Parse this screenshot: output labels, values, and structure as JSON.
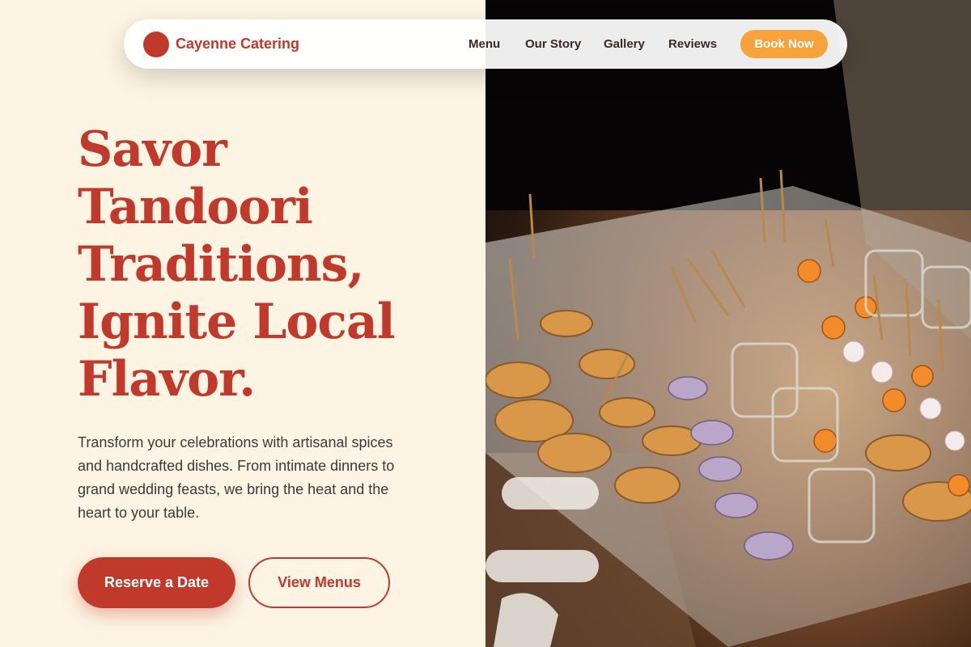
{
  "brand": {
    "name": "Cayenne Catering",
    "color": "#c0392b",
    "logo_icon": "red-circle-logo-icon"
  },
  "nav": {
    "links": [
      "Menu",
      "Our Story",
      "Gallery",
      "Reviews"
    ],
    "cta": "Book Now",
    "cta_color": "#f7a23b"
  },
  "hero": {
    "headline_lines": [
      "Savor",
      "Tandoori",
      "Traditions,",
      "Ignite Local",
      "Flavor."
    ],
    "description": "Transform your celebrations with artisanal spices and handcrafted dishes. From intimate dinners to grand wedding feasts, we bring the heat and the heart to your table.",
    "primary_button": "Reserve a Date",
    "secondary_button": "View Menus",
    "background_color": "#fdf4e3",
    "image": "catering-appetizers-photo"
  }
}
